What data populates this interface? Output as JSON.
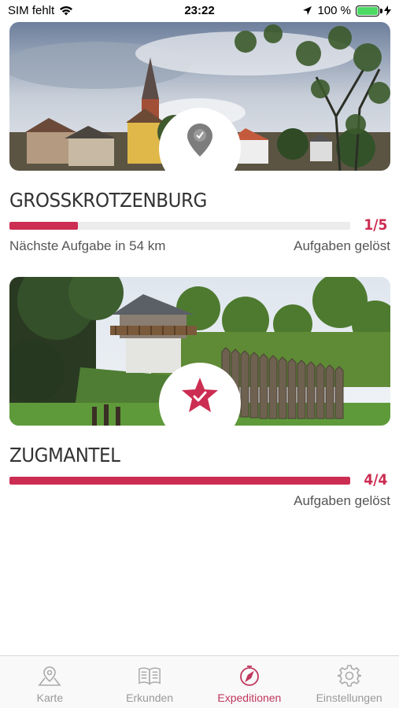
{
  "status": {
    "carrier": "SIM fehlt",
    "time": "23:22",
    "battery": "100 %"
  },
  "cards": [
    {
      "title": "GROSSKROTZENBURG",
      "progress_count": "1/5",
      "progress": 0.2,
      "next_task": "Nächste Aufgabe in 54 km",
      "status_label": "Aufgaben gelöst",
      "badge_icon": "location-pin-check-icon"
    },
    {
      "title": "ZUGMANTEL",
      "progress_count": "4/4",
      "progress": 1.0,
      "status_label": "Aufgaben gelöst",
      "badge_icon": "star-check-icon"
    }
  ],
  "tabs": [
    {
      "label": "Karte",
      "icon": "map-pin-icon",
      "active": false
    },
    {
      "label": "Erkunden",
      "icon": "book-icon",
      "active": false
    },
    {
      "label": "Expeditionen",
      "icon": "compass-icon",
      "active": true
    },
    {
      "label": "Einstellungen",
      "icon": "gear-icon",
      "active": false
    }
  ],
  "colors": {
    "accent": "#cc2d52",
    "active_tab": "#c0375d",
    "track": "#ececec",
    "battery": "#4cd964"
  }
}
